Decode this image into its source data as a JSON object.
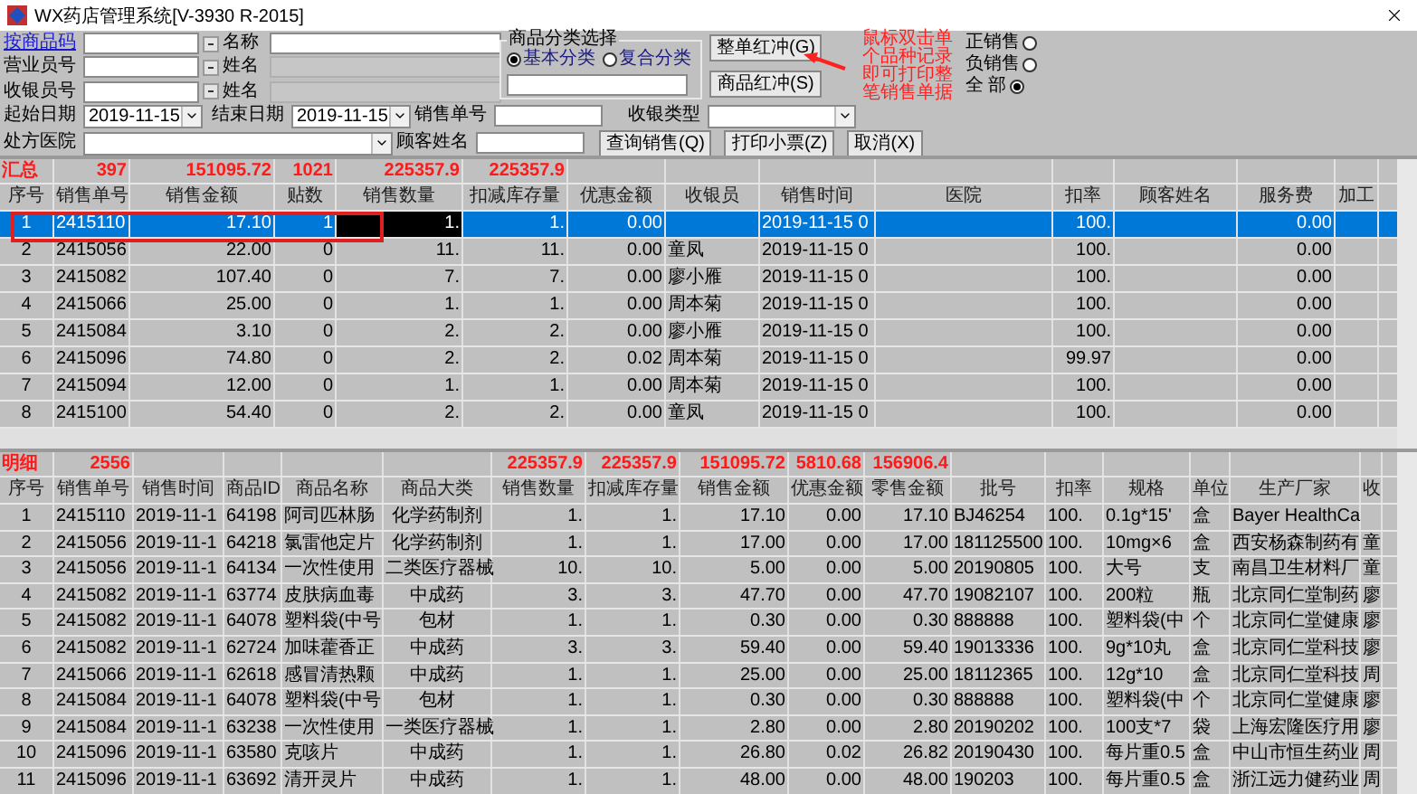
{
  "title": "WX药店管理系统[V-3930 R-2015]",
  "form": {
    "lookup_rows": [
      {
        "label": "按商品码",
        "link": true,
        "name_label": "名称",
        "name_disabled": false
      },
      {
        "label": "营业员号",
        "link": false,
        "name_label": "姓名",
        "name_disabled": true
      },
      {
        "label": "收银员号",
        "link": false,
        "name_label": "姓名",
        "name_disabled": true
      }
    ],
    "category_group": {
      "title": "商品分类选择",
      "options": [
        {
          "label": "基本分类",
          "selected": true
        },
        {
          "label": "复合分类",
          "selected": false
        }
      ]
    },
    "red_buttons": [
      "整单红冲(G)",
      "商品红冲(S)"
    ],
    "note": "鼠标双击单个品种记录即可打印整笔销售单据",
    "sale_filter": [
      {
        "label": "正销售",
        "selected": false
      },
      {
        "label": "负销售",
        "selected": false
      },
      {
        "label": "全 部",
        "selected": true
      }
    ],
    "start_date": {
      "label": "起始日期",
      "value": "2019-11-15"
    },
    "end_date": {
      "label": "结束日期",
      "value": "2019-11-15"
    },
    "order_no": {
      "label": "销售单号"
    },
    "cash_type": {
      "label": "收银类型"
    },
    "hospital": {
      "label": "处方医院"
    },
    "customer": {
      "label": "顾客姓名"
    },
    "actions": [
      "查询销售(Q)",
      "打印小票(Z)",
      "取消(X)"
    ]
  },
  "summary_table": {
    "caption": "汇总",
    "columns": [
      {
        "label": "序号",
        "kind": "center",
        "current": false
      },
      {
        "label": "销售单号",
        "kind": "text",
        "current": false,
        "total": "397"
      },
      {
        "label": "销售金额",
        "kind": "number",
        "current": false,
        "total": "151095.72"
      },
      {
        "label": "贴数",
        "kind": "number",
        "current": false,
        "total": "1021"
      },
      {
        "label": "销售数量",
        "kind": "number",
        "current": true,
        "total": "225357.9"
      },
      {
        "label": "扣减库存量",
        "kind": "number",
        "current": false,
        "total": "225357.9"
      },
      {
        "label": "优惠金额",
        "kind": "number",
        "current": false
      },
      {
        "label": "收银员",
        "kind": "text",
        "current": false
      },
      {
        "label": "销售时间",
        "kind": "text",
        "current": false
      },
      {
        "label": "医院",
        "kind": "text",
        "current": false
      },
      {
        "label": "扣率",
        "kind": "number",
        "current": false
      },
      {
        "label": "顾客姓名",
        "kind": "text",
        "current": false
      },
      {
        "label": "服务费",
        "kind": "number",
        "current": false
      },
      {
        "label": "加工",
        "kind": "text",
        "current": false
      }
    ],
    "rows": [
      {
        "selected": true,
        "cells": [
          "1",
          "2415110",
          "17.10",
          "1",
          "1.",
          "1.",
          "0.00",
          null,
          "2019-11-15 0",
          null,
          "100.",
          null,
          "0.00",
          null
        ]
      },
      {
        "selected": false,
        "cells": [
          "2",
          "2415056",
          "22.00",
          "0",
          "11.",
          "11.",
          "0.00",
          "童凤",
          "2019-11-15 0",
          null,
          "100.",
          null,
          "0.00",
          null
        ]
      },
      {
        "selected": false,
        "cells": [
          "3",
          "2415082",
          "107.40",
          "0",
          "7.",
          "7.",
          "0.00",
          "廖小雁",
          "2019-11-15 0",
          null,
          "100.",
          null,
          "0.00",
          null
        ]
      },
      {
        "selected": false,
        "cells": [
          "4",
          "2415066",
          "25.00",
          "0",
          "1.",
          "1.",
          "0.00",
          "周本菊",
          "2019-11-15 0",
          null,
          "100.",
          null,
          "0.00",
          null
        ]
      },
      {
        "selected": false,
        "cells": [
          "5",
          "2415084",
          "3.10",
          "0",
          "2.",
          "2.",
          "0.00",
          "廖小雁",
          "2019-11-15 0",
          null,
          "100.",
          null,
          "0.00",
          null
        ]
      },
      {
        "selected": false,
        "cells": [
          "6",
          "2415096",
          "74.80",
          "0",
          "2.",
          "2.",
          "0.02",
          "周本菊",
          "2019-11-15 0",
          null,
          "99.97",
          null,
          "0.00",
          null
        ]
      },
      {
        "selected": false,
        "cells": [
          "7",
          "2415094",
          "12.00",
          "0",
          "1.",
          "1.",
          "0.00",
          "周本菊",
          "2019-11-15 0",
          null,
          "100.",
          null,
          "0.00",
          null
        ]
      },
      {
        "selected": false,
        "cells": [
          "8",
          "2415100",
          "54.40",
          "0",
          "2.",
          "2.",
          "0.00",
          "童凤",
          "2019-11-15 0",
          null,
          "100.",
          null,
          "0.00",
          null
        ]
      }
    ]
  },
  "detail_table": {
    "caption": "明细",
    "columns": [
      {
        "label": "序号",
        "kind": "center"
      },
      {
        "label": "销售单号",
        "kind": "text",
        "total": "2556"
      },
      {
        "label": "销售时间",
        "kind": "text"
      },
      {
        "label": "商品ID",
        "kind": "text"
      },
      {
        "label": "商品名称",
        "kind": "text"
      },
      {
        "label": "商品大类",
        "kind": "center"
      },
      {
        "label": "销售数量",
        "kind": "number",
        "total": "225357.9"
      },
      {
        "label": "扣减库存量",
        "kind": "number",
        "total": "225357.9"
      },
      {
        "label": "销售金额",
        "kind": "number",
        "total": "151095.72"
      },
      {
        "label": "优惠金额",
        "kind": "number",
        "total": "5810.68"
      },
      {
        "label": "零售金额",
        "kind": "number",
        "total": "156906.4"
      },
      {
        "label": "批号",
        "kind": "text"
      },
      {
        "label": "扣率",
        "kind": "text"
      },
      {
        "label": "规格",
        "kind": "text"
      },
      {
        "label": "单位",
        "kind": "text"
      },
      {
        "label": "生产厂家",
        "kind": "text"
      },
      {
        "label": "收",
        "kind": "text"
      }
    ],
    "rows": [
      {
        "selected": false,
        "cells": [
          "1",
          "2415110",
          "2019-11-1",
          "64198",
          "阿司匹林肠",
          "化学药制剂",
          "1.",
          "1.",
          "17.10",
          "0.00",
          "17.10",
          "BJ46254",
          "100.",
          "0.1g*15'",
          "盒",
          "Bayer HealthCa",
          null
        ]
      },
      {
        "selected": false,
        "cells": [
          "2",
          "2415056",
          "2019-11-1",
          "64218",
          "氯雷他定片",
          "化学药制剂",
          "1.",
          "1.",
          "17.00",
          "0.00",
          "17.00",
          "181125500",
          "100.",
          "10mg×6",
          "盒",
          "西安杨森制药有",
          "童"
        ]
      },
      {
        "selected": false,
        "cells": [
          "3",
          "2415056",
          "2019-11-1",
          "64134",
          "一次性使用",
          "二类医疗器械",
          "10.",
          "10.",
          "5.00",
          "0.00",
          "5.00",
          "20190805",
          "100.",
          "大号",
          "支",
          "南昌卫生材料厂",
          "童"
        ]
      },
      {
        "selected": false,
        "cells": [
          "4",
          "2415082",
          "2019-11-1",
          "63774",
          "皮肤病血毒",
          "中成药",
          "3.",
          "3.",
          "47.70",
          "0.00",
          "47.70",
          "19082107",
          "100.",
          "200粒",
          "瓶",
          "北京同仁堂制药",
          "廖"
        ]
      },
      {
        "selected": false,
        "cells": [
          "5",
          "2415082",
          "2019-11-1",
          "64078",
          "塑料袋(中号",
          "包材",
          "1.",
          "1.",
          "0.30",
          "0.00",
          "0.30",
          "888888",
          "100.",
          "塑料袋(中",
          "个",
          "北京同仁堂健康",
          "廖"
        ]
      },
      {
        "selected": false,
        "cells": [
          "6",
          "2415082",
          "2019-11-1",
          "62724",
          "加味藿香正",
          "中成药",
          "3.",
          "3.",
          "59.40",
          "0.00",
          "59.40",
          "19013336",
          "100.",
          "9g*10丸",
          "盒",
          "北京同仁堂科技",
          "廖"
        ]
      },
      {
        "selected": false,
        "cells": [
          "7",
          "2415066",
          "2019-11-1",
          "62618",
          "感冒清热颗",
          "中成药",
          "1.",
          "1.",
          "25.00",
          "0.00",
          "25.00",
          "18112365",
          "100.",
          "12g*10",
          "盒",
          "北京同仁堂科技",
          "周"
        ]
      },
      {
        "selected": false,
        "cells": [
          "8",
          "2415084",
          "2019-11-1",
          "64078",
          "塑料袋(中号",
          "包材",
          "1.",
          "1.",
          "0.30",
          "0.00",
          "0.30",
          "888888",
          "100.",
          "塑料袋(中",
          "个",
          "北京同仁堂健康",
          "廖"
        ]
      },
      {
        "selected": false,
        "cells": [
          "9",
          "2415084",
          "2019-11-1",
          "63238",
          "一次性使用",
          "一类医疗器械",
          "1.",
          "1.",
          "2.80",
          "0.00",
          "2.80",
          "20190202",
          "100.",
          "100支*7",
          "袋",
          "上海宏隆医疗用",
          "廖"
        ]
      },
      {
        "selected": false,
        "cells": [
          "10",
          "2415096",
          "2019-11-1",
          "63580",
          "克咳片",
          "中成药",
          "1.",
          "1.",
          "26.80",
          "0.02",
          "26.82",
          "20190430",
          "100.",
          "每片重0.5",
          "盒",
          "中山市恒生药业",
          "周"
        ]
      },
      {
        "selected": false,
        "cells": [
          "11",
          "2415096",
          "2019-11-1",
          "63692",
          "清开灵片",
          "中成药",
          "1.",
          "1.",
          "48.00",
          "0.00",
          "48.00",
          "190203",
          "100.",
          "每片重0.5",
          "盒",
          "浙江远力健药业",
          "周"
        ]
      }
    ]
  }
}
